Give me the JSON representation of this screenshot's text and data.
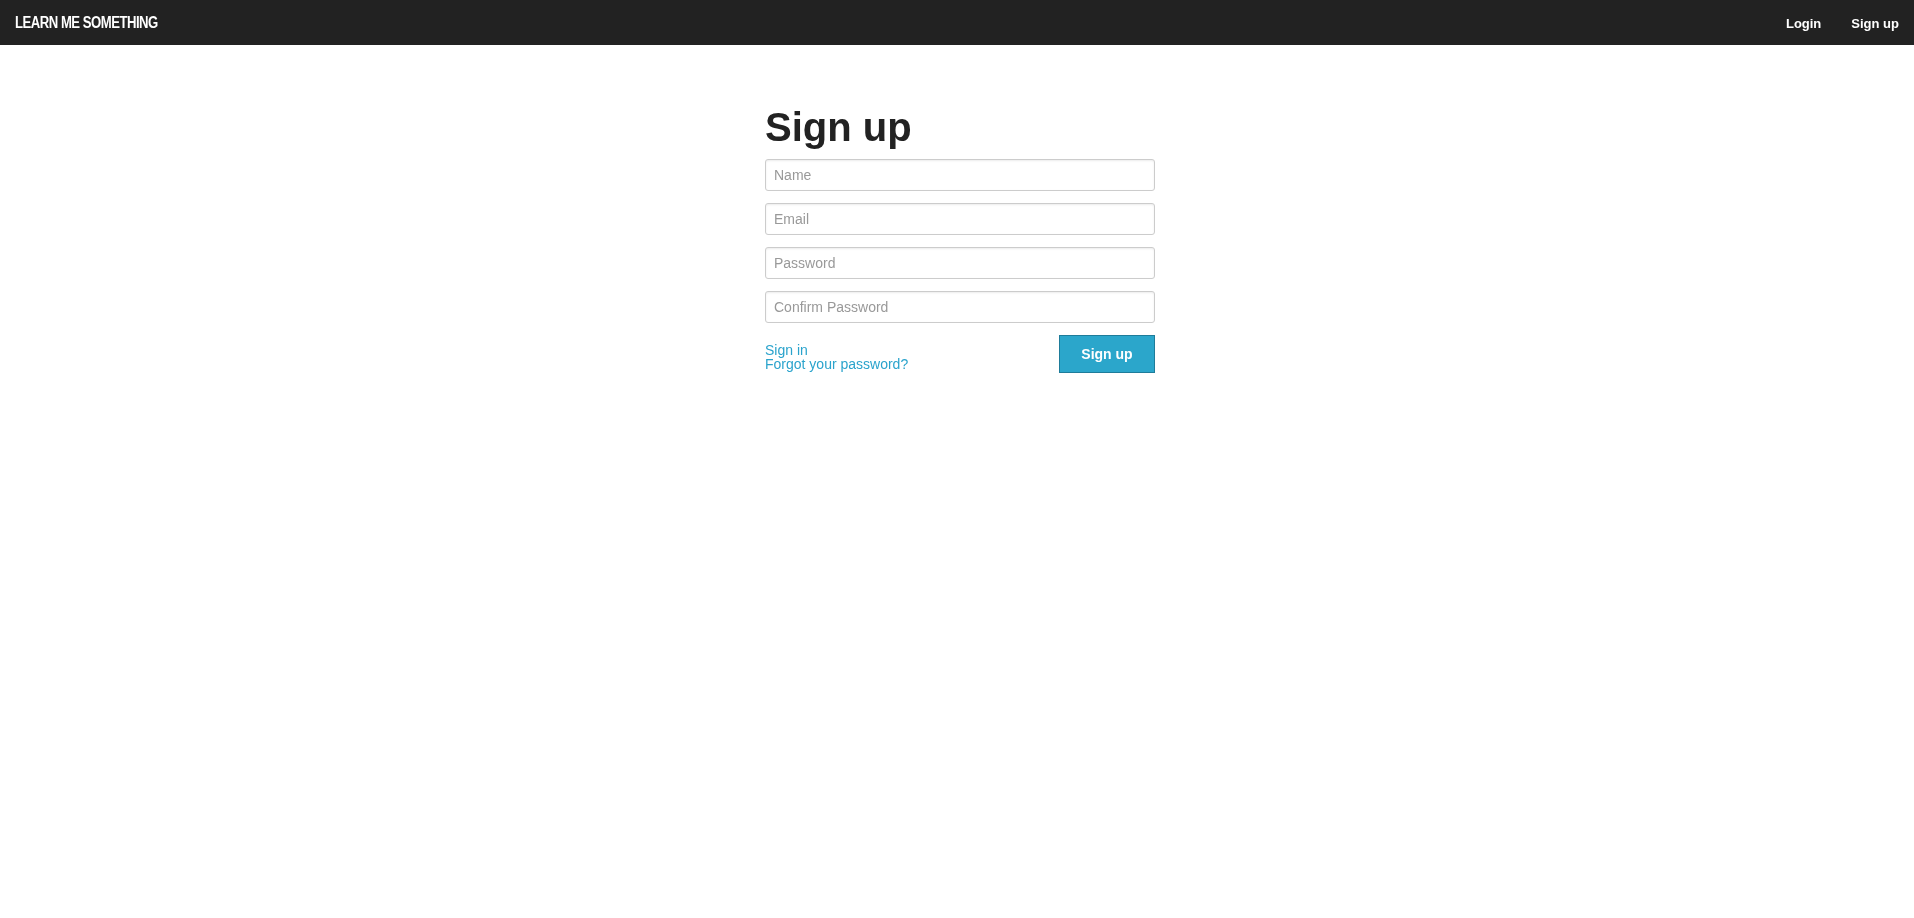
{
  "header": {
    "logo": "LEARN ME SOMETHING",
    "nav": [
      "Login",
      "Sign up"
    ]
  },
  "form": {
    "title": "Sign up",
    "fields": [
      {
        "placeholder": "Name"
      },
      {
        "placeholder": "Email"
      },
      {
        "placeholder": "Password"
      },
      {
        "placeholder": "Confirm Password"
      }
    ],
    "links": [
      "Sign in",
      "Forgot your password?"
    ],
    "submit": "Sign up"
  }
}
